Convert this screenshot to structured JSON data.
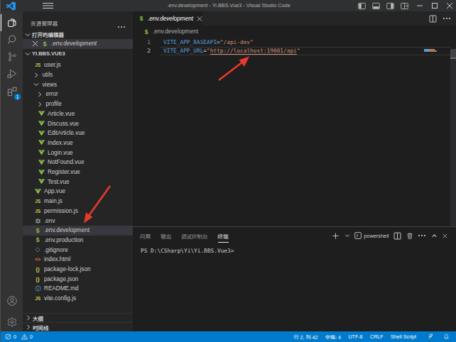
{
  "window": {
    "title": ".env.development - Yi.BBS.Vue3 - Visual Studio Code"
  },
  "colors": {
    "status_bar": "#007acc",
    "badge": "#007acc",
    "annotation_arrow": "#e8392e",
    "code_key": "#569cd6",
    "code_string": "#ce9178"
  },
  "activity_bar": {
    "items": [
      {
        "name": "explorer",
        "active": true
      },
      {
        "name": "search",
        "active": false
      },
      {
        "name": "source-control",
        "active": false
      },
      {
        "name": "run-debug",
        "active": false
      },
      {
        "name": "extensions",
        "active": false,
        "badge": "1"
      }
    ],
    "bottom_items": [
      {
        "name": "account"
      },
      {
        "name": "settings"
      }
    ]
  },
  "sidebar": {
    "title": "资源管理器",
    "more_actions": "···",
    "open_editors": {
      "label": "打开的编辑器",
      "file": {
        "label": ".env.development",
        "icon": "dollar",
        "selected": true
      }
    },
    "project_label": "YI.BBS.VUE3",
    "tree": [
      {
        "label": "user.js",
        "icon": "js",
        "level": 1
      },
      {
        "label": "utils",
        "icon": "chevron-right",
        "level": 1
      },
      {
        "label": "views",
        "icon": "chevron-down",
        "level": 1
      },
      {
        "label": "error",
        "icon": "chevron-right",
        "level": 2
      },
      {
        "label": "profile",
        "icon": "chevron-right",
        "level": 2
      },
      {
        "label": "Article.vue",
        "icon": "vue",
        "level": 2
      },
      {
        "label": "Discuss.vue",
        "icon": "vue",
        "level": 2
      },
      {
        "label": "EditArticle.vue",
        "icon": "vue",
        "level": 2
      },
      {
        "label": "Index.vue",
        "icon": "vue",
        "level": 2
      },
      {
        "label": "Login.vue",
        "icon": "vue",
        "level": 2
      },
      {
        "label": "NotFound.vue",
        "icon": "vue",
        "level": 2
      },
      {
        "label": "Register.vue",
        "icon": "vue",
        "level": 2
      },
      {
        "label": "Test.vue",
        "icon": "vue",
        "level": 2
      },
      {
        "label": "App.vue",
        "icon": "vue",
        "level": 1
      },
      {
        "label": "main.js",
        "icon": "js",
        "level": 1
      },
      {
        "label": "permission.js",
        "icon": "js",
        "level": 1
      },
      {
        "label": ".env",
        "icon": "gear",
        "level": 1
      },
      {
        "label": ".env.development",
        "icon": "dollar",
        "level": 1,
        "selected": true
      },
      {
        "label": ".env.production",
        "icon": "dollar",
        "level": 1
      },
      {
        "label": ".gitignore",
        "icon": "diamond",
        "level": 1
      },
      {
        "label": "index.html",
        "icon": "html",
        "level": 1
      },
      {
        "label": "package-lock.json",
        "icon": "braces",
        "level": 1
      },
      {
        "label": "package.json",
        "icon": "braces",
        "level": 1
      },
      {
        "label": "README.md",
        "icon": "info",
        "level": 1
      },
      {
        "label": "vite.config.js",
        "icon": "js",
        "level": 1
      }
    ],
    "bottom_sections": [
      {
        "label": "大纲"
      },
      {
        "label": "时间线"
      }
    ]
  },
  "editor": {
    "tab": {
      "label": ".env.development",
      "icon": "dollar"
    },
    "breadcrumb": {
      "label": ".env.development",
      "icon": "dollar"
    },
    "lines": [
      {
        "number": "1",
        "tokens": [
          {
            "t": "key",
            "v": "VITE_APP_BASEAPI"
          },
          {
            "t": "op",
            "v": "="
          },
          {
            "t": "str",
            "v": "\"/api-dev\""
          }
        ]
      },
      {
        "number": "2",
        "active": true,
        "tokens": [
          {
            "t": "key",
            "v": "VITE_APP_URL"
          },
          {
            "t": "op",
            "v": "="
          },
          {
            "t": "str",
            "v": "\""
          },
          {
            "t": "link",
            "v": "http://localhost:19001/api"
          },
          {
            "t": "str",
            "v": "\""
          }
        ]
      }
    ]
  },
  "panel": {
    "tabs": [
      {
        "label": "问题"
      },
      {
        "label": "输出"
      },
      {
        "label": "调试控制台"
      },
      {
        "label": "终端",
        "active": true
      }
    ],
    "shell_label": "powershell",
    "terminal_line": "PS D:\\CSharp\\Yi\\Yi.BBS.Vue3>"
  },
  "status_bar": {
    "errors": "0",
    "warnings": "0",
    "cursor_position": "行 2, 列 42",
    "indentation": "空格: 4",
    "encoding": "UTF-8",
    "eol": "CRLF",
    "language": "Shell Script"
  }
}
